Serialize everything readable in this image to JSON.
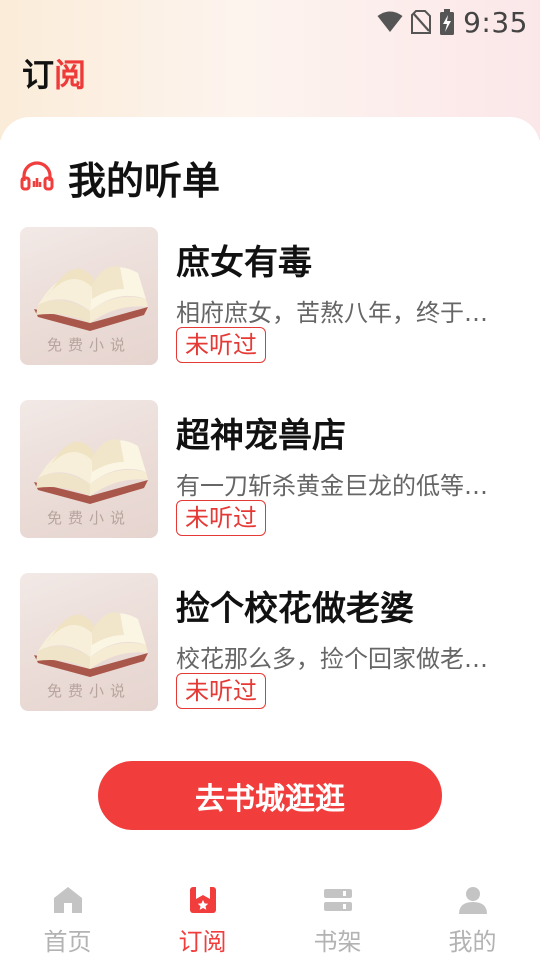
{
  "status_bar": {
    "time": "9:35",
    "icons": [
      "wifi-icon",
      "no-sim-icon",
      "battery-charging-icon"
    ]
  },
  "header": {
    "title_part1": "订",
    "title_part2": "阅"
  },
  "section": {
    "icon": "headphones-icon",
    "title": "我的听单"
  },
  "books": [
    {
      "title": "庶女有毒",
      "description": "相府庶女，苦熬八年，终于…",
      "status": "未听过",
      "cover_watermark": "免费小说"
    },
    {
      "title": "超神宠兽店",
      "description": "有一刀斩杀黄金巨龙的低等…",
      "status": "未听过",
      "cover_watermark": "免费小说"
    },
    {
      "title": "捡个校花做老婆",
      "description": "校花那么多，捡个回家做老…",
      "status": "未听过",
      "cover_watermark": "免费小说"
    }
  ],
  "cta": {
    "label": "去书城逛逛"
  },
  "tabbar": {
    "tabs": [
      {
        "label": "首页",
        "icon": "home-icon",
        "active": false
      },
      {
        "label": "订阅",
        "icon": "bookmark-star-icon",
        "active": true
      },
      {
        "label": "书架",
        "icon": "bookshelf-icon",
        "active": false
      },
      {
        "label": "我的",
        "icon": "person-icon",
        "active": false
      }
    ]
  },
  "colors": {
    "accent": "#f23d3d",
    "inactive_tab": "#b3b3b3",
    "badge_border": "#e53935"
  }
}
